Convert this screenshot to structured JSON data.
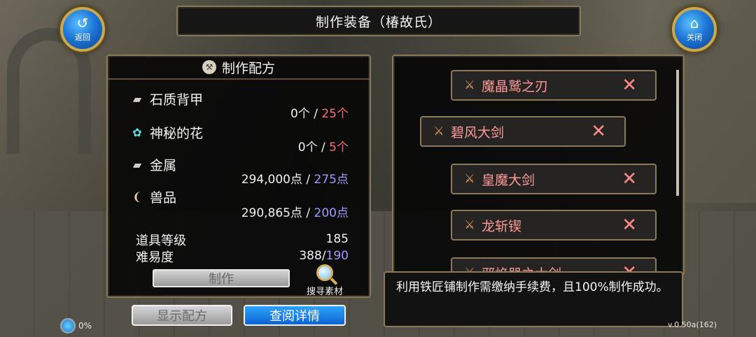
{
  "window": {
    "title": "制作装备（椿故氏）"
  },
  "nav": {
    "back": {
      "icon": "back-arrow-icon",
      "label": "返回"
    },
    "close": {
      "icon": "home-icon",
      "label": "关闭"
    }
  },
  "recipe": {
    "header": "制作配方",
    "materials": [
      {
        "name": "石质背甲",
        "icon": "stone-armor-icon",
        "have": "0个",
        "sep": " / ",
        "need": "25个",
        "need_color": "#ff6f6f"
      },
      {
        "name": "神秘的花",
        "icon": "mystic-flower-icon",
        "have": "0个",
        "sep": " / ",
        "need": "5个",
        "need_color": "#ff6f6f"
      },
      {
        "name": "金属",
        "icon": "metal-icon",
        "have": "294,000点",
        "sep": " / ",
        "need": "275点",
        "need_color": "#9f9aff"
      },
      {
        "name": "兽品",
        "icon": "beast-claw-icon",
        "have": "290,865点",
        "sep": " / ",
        "need": "200点",
        "need_color": "#9f9aff"
      }
    ],
    "item_level": {
      "label": "道具等级",
      "value": "185"
    },
    "difficulty": {
      "label": "难易度",
      "current": "388",
      "sep": "/",
      "max": "190"
    },
    "make_button": "制作",
    "search_label": "搜寻素材"
  },
  "buttons": {
    "show_recipe": "显示配方",
    "view_details": "查阅详情"
  },
  "item_list": [
    {
      "name": "魔晶鹫之刃",
      "icon": "sword-icon"
    },
    {
      "name": "碧风大剑",
      "icon": "sword-icon"
    },
    {
      "name": "皇魔大剑",
      "icon": "sword-icon"
    },
    {
      "name": "龙斩锲",
      "icon": "sword-icon"
    },
    {
      "name": "邪焰器之大剑",
      "icon": "sword-icon"
    }
  ],
  "tooltip": "利用铁匠铺制作需缴纳手续费，且100%制作成功。",
  "status": {
    "percent": "0%",
    "version": "v.0.50a(162)"
  },
  "colors": {
    "frame_gold": "#8a7a58",
    "item_name_red": "#ff9a9a",
    "need_red": "#ff6f6f",
    "need_blue": "#9f9aff",
    "detail_blue": "#0b63d0"
  }
}
